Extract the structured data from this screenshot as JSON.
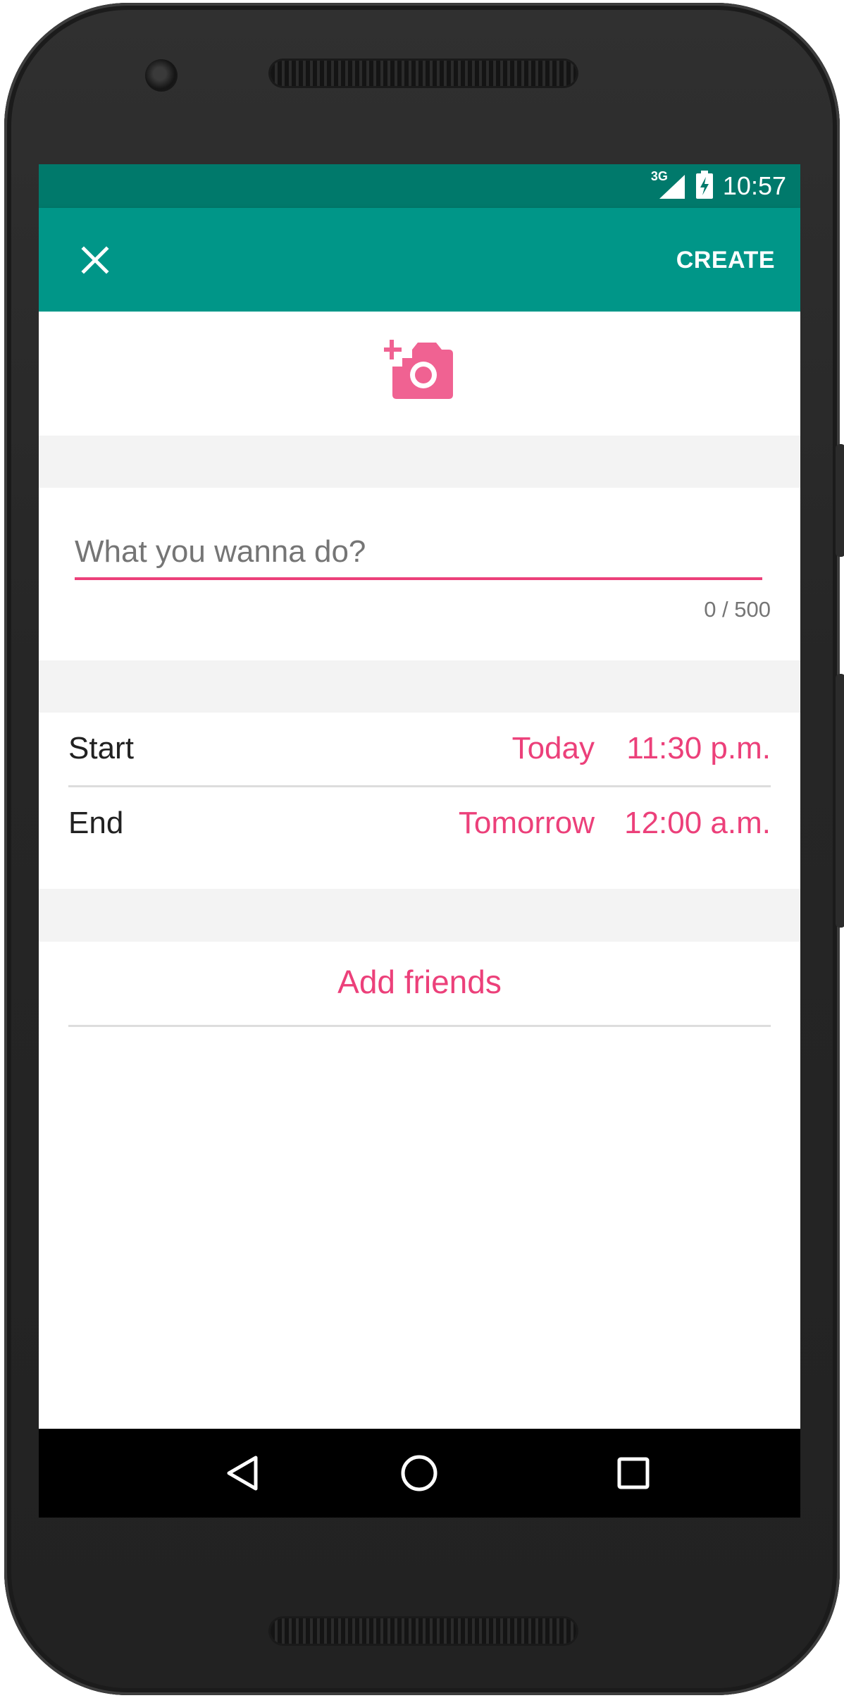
{
  "status_bar": {
    "network_label": "3G",
    "time": "10:57",
    "icons": [
      "signal-icon",
      "battery-charging-icon"
    ]
  },
  "app_bar": {
    "close_icon": "close-icon",
    "create_label": "CREATE"
  },
  "photo": {
    "icon": "add-photo-icon"
  },
  "activity_input": {
    "value": "",
    "placeholder": "What you wanna do?",
    "counter": "0 / 500"
  },
  "schedule": {
    "start": {
      "label": "Start",
      "date": "Today",
      "time": "11:30 p.m."
    },
    "end": {
      "label": "End",
      "date": "Tomorrow",
      "time": "12:00 a.m."
    }
  },
  "friends": {
    "add_label": "Add friends"
  },
  "nav_bar": {
    "icons": [
      "back-icon",
      "home-icon",
      "recents-icon"
    ]
  },
  "colors": {
    "status_bar": "#00796b",
    "app_bar": "#009688",
    "accent": "#ec407a",
    "section_gap": "#f3f3f3",
    "nav_bar": "#000000",
    "device_body": "#262626"
  }
}
